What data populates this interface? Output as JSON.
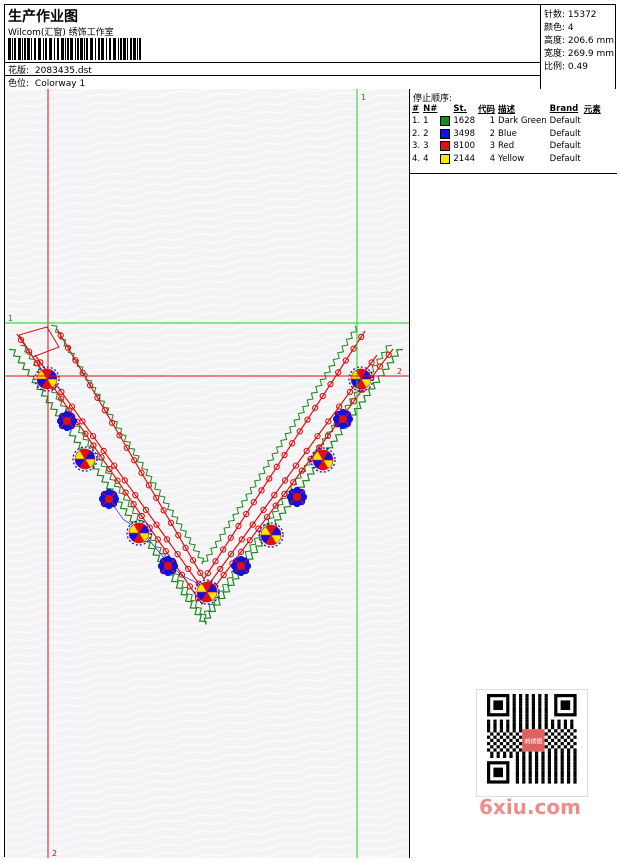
{
  "header": {
    "title": "生产作业图",
    "company": "Wilcom(汇窗) 绣饰工作室",
    "design_label": "花版:",
    "design_value": "2083435.dst",
    "colorway_label": "色位:",
    "colorway_value": "Colorway 1"
  },
  "stats": {
    "stitches": "针数: 15372",
    "colors": "颜色: 4",
    "height": "高度: 206.6 mm",
    "width": "宽度: 269.9 mm",
    "scale": "比例: 0.49"
  },
  "stop_sequence": {
    "title": "停止顺序:",
    "columns": [
      "#",
      "N#",
      "St.",
      "代码",
      "描述",
      "Brand",
      "元素"
    ],
    "rows": [
      {
        "idx": "1.",
        "n": "1",
        "color": "#1a8a1a",
        "stitches": "1628",
        "code": "1",
        "desc": "Dark Green",
        "brand": "Default"
      },
      {
        "idx": "2.",
        "n": "2",
        "color": "#1010e0",
        "stitches": "3498",
        "code": "2",
        "desc": "Blue",
        "brand": "Default"
      },
      {
        "idx": "3.",
        "n": "3",
        "color": "#e01010",
        "stitches": "8100",
        "code": "3",
        "desc": "Red",
        "brand": "Default"
      },
      {
        "idx": "4.",
        "n": "4",
        "color": "#f5e800",
        "stitches": "2144",
        "code": "4",
        "desc": "Yellow",
        "brand": "Default"
      }
    ]
  },
  "guides": {
    "green_top": "1",
    "green_left": "1",
    "red_bottom": "2",
    "red_right": "2"
  },
  "watermark": "6xiu.com",
  "qr_badge": "刺绣图"
}
